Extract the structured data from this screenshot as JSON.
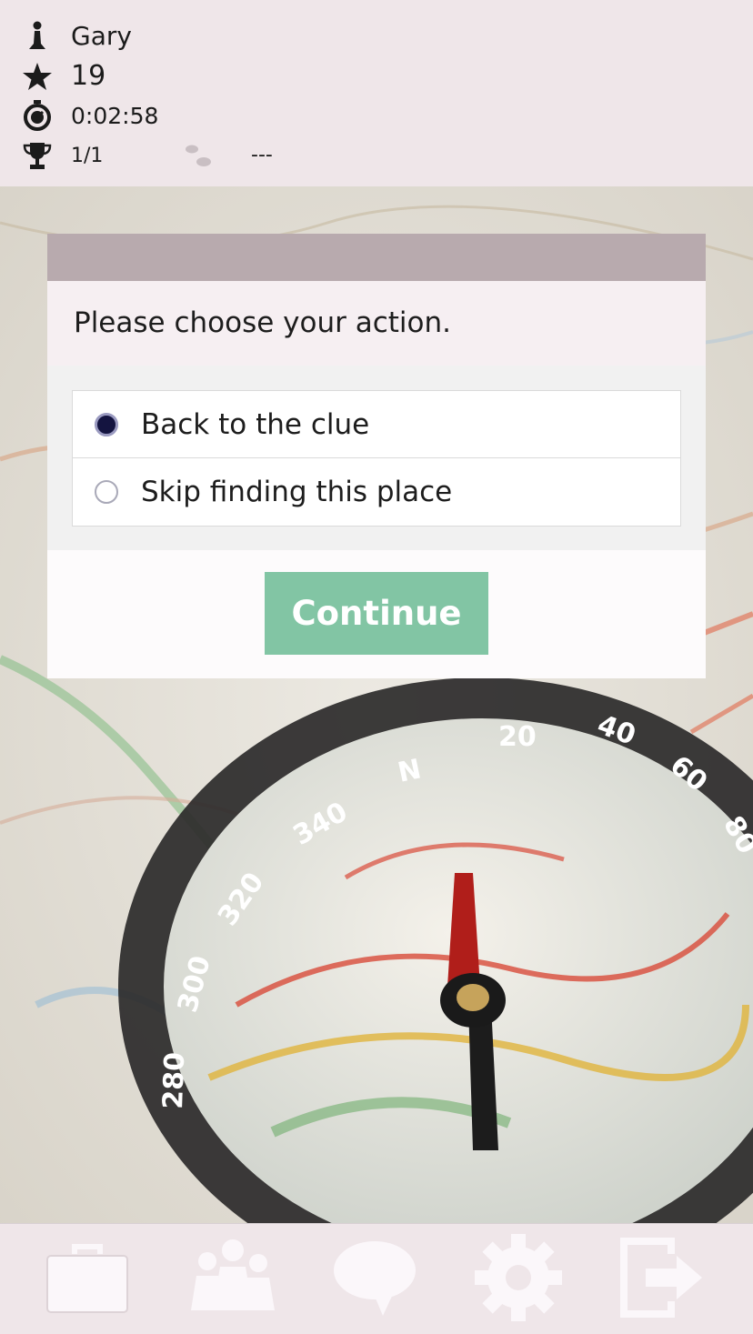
{
  "header": {
    "player_name": "Gary",
    "score": "19",
    "time": "0:02:58",
    "rank": "1/1",
    "steps": "---",
    "icons": [
      "pawn-icon",
      "star-icon",
      "stopwatch-icon",
      "trophy-icon",
      "footsteps-icon"
    ]
  },
  "dialog": {
    "message": "Please choose your action.",
    "options": [
      {
        "label": "Back to the clue",
        "selected": true
      },
      {
        "label": "Skip finding this place",
        "selected": false
      }
    ],
    "continue_label": "Continue"
  },
  "toolbar": {
    "items": [
      "briefcase-icon",
      "team-icon",
      "chat-icon",
      "settings-icon",
      "exit-icon"
    ]
  },
  "colors": {
    "header_bg": "#efe6e9",
    "title_bar": "#b8aaae",
    "continue_button": "#82c5a4",
    "radio_selected": "#141440",
    "toolbar_icon": "#fbf7fa"
  }
}
